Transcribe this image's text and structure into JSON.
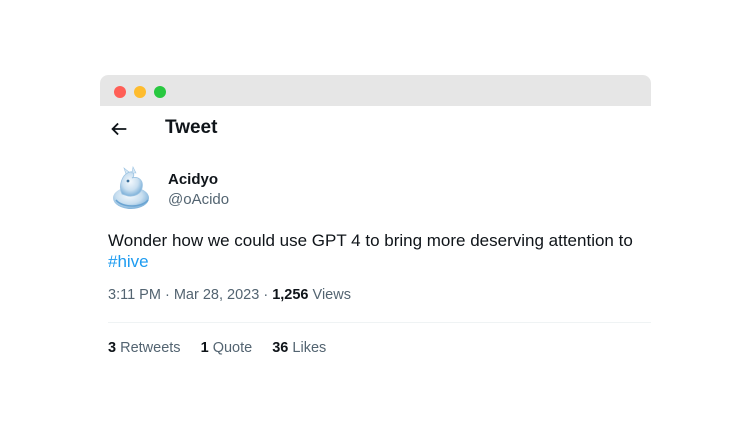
{
  "header": {
    "title": "Tweet",
    "back_icon": "arrow-left-icon"
  },
  "author": {
    "display_name": "Acidyo",
    "handle": "@oAcido"
  },
  "tweet": {
    "text": "Wonder how we could use GPT 4 to bring more deserving attention to ",
    "hashtag": "#hive",
    "time": "3:11 PM",
    "separator": "·",
    "date": "Mar 28, 2023",
    "views_count": "1,256",
    "views_label": "Views"
  },
  "stats": {
    "retweets_count": "3",
    "retweets_label": "Retweets",
    "quotes_count": "1",
    "quotes_label": "Quote",
    "likes_count": "36",
    "likes_label": "Likes"
  },
  "colors": {
    "accent": "#1d9bf0",
    "text_primary": "#0f1419",
    "text_secondary": "#536471",
    "titlebar": "#e6e6e6"
  }
}
